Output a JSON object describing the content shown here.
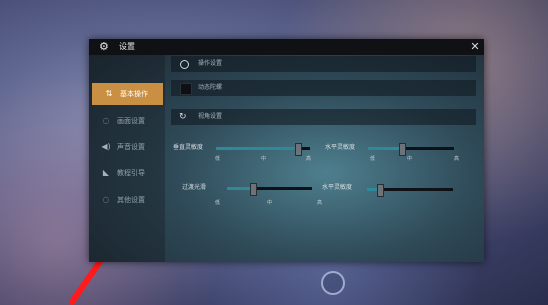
{
  "dialog": {
    "title": "设置",
    "close_label": "✕",
    "gear_icon": "gear-icon"
  },
  "sidebar": {
    "items": [
      {
        "label": "基本操作",
        "icon": "⇅",
        "active": true
      },
      {
        "label": "画面设置",
        "icon": "◌",
        "active": false
      },
      {
        "label": "声音设置",
        "icon": "◀)",
        "active": false
      },
      {
        "label": "教程引导",
        "icon": "◣",
        "active": false
      },
      {
        "label": "其他设置",
        "icon": "◌",
        "active": false
      }
    ]
  },
  "rows": {
    "row1_text": "操作设置",
    "row2_text": "动态陀螺",
    "row3_text": "视角设置"
  },
  "sliders": {
    "vertical": {
      "label": "垂直灵敏度",
      "low": "低",
      "mid": "中",
      "high": "高",
      "value": 0.87
    },
    "horizontal": {
      "label": "水平灵敏度",
      "low": "低",
      "mid": "中",
      "high": "高",
      "value": 0.4
    },
    "transition": {
      "label": "过渡光滑",
      "low": "低",
      "mid": "中",
      "high": "高",
      "value": 0.3
    },
    "horizontal2": {
      "label": "水平灵敏度",
      "value": 0.15
    }
  },
  "colors": {
    "accent": "#c98f43",
    "slider_fill": "#2f8a97"
  }
}
